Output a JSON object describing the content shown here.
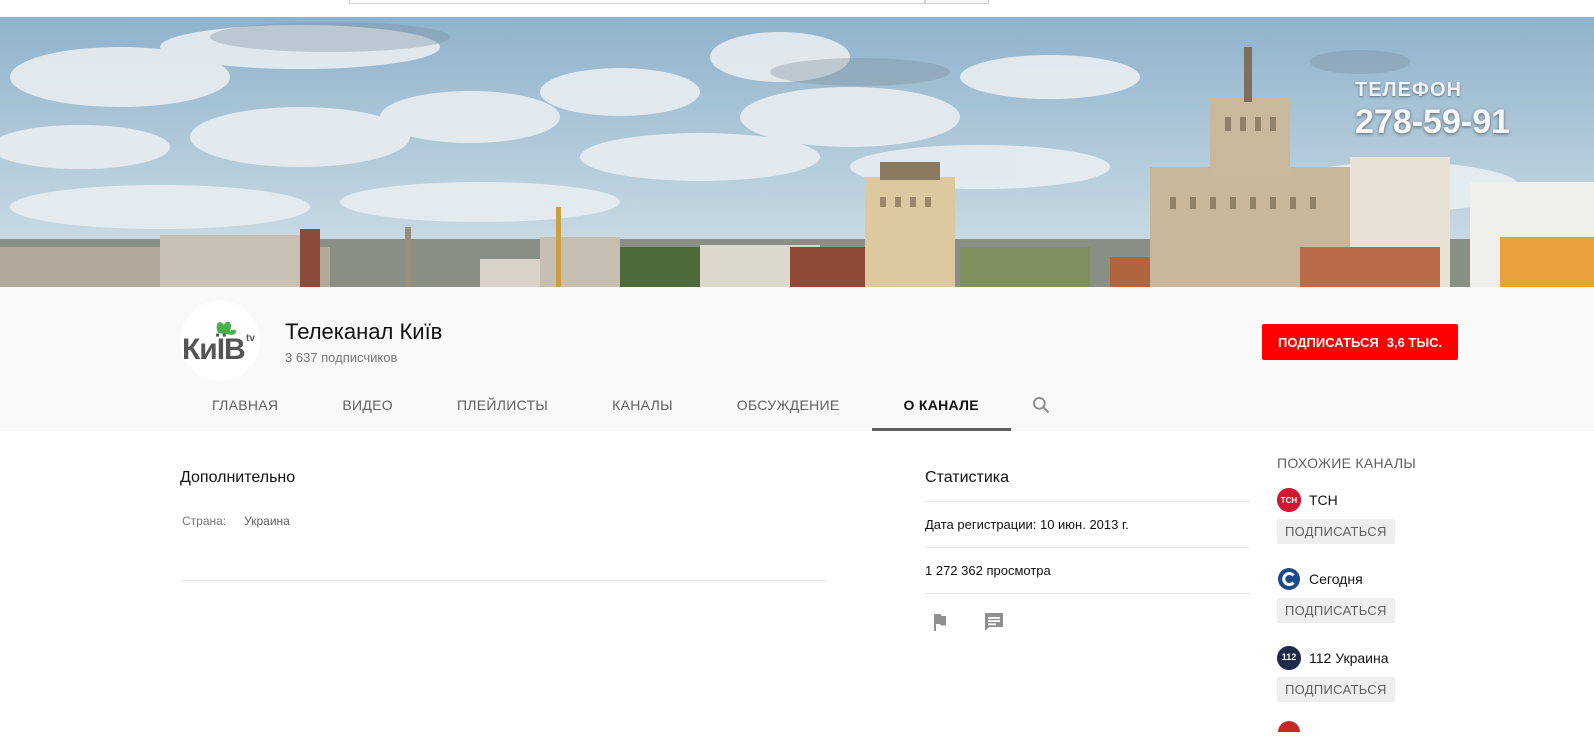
{
  "banner": {
    "phone_label": "ТЕЛЕФОН",
    "phone_number": "278-59-91"
  },
  "channel": {
    "title": "Телеканал Київ",
    "subscribers": "3 637 подписчиков",
    "subscribe_label": "ПОДПИСАТЬСЯ",
    "subscribe_count": "3,6 ТЫС.",
    "logo_text": "КиЇВ",
    "logo_suffix": "tv"
  },
  "tabs": [
    {
      "label": "ГЛАВНАЯ"
    },
    {
      "label": "ВИДЕО"
    },
    {
      "label": "ПЛЕЙЛИСТЫ"
    },
    {
      "label": "КАНАЛЫ"
    },
    {
      "label": "ОБСУЖДЕНИЕ"
    },
    {
      "label": "О КАНАЛЕ"
    }
  ],
  "active_tab": "О КАНАЛЕ",
  "about": {
    "title": "Дополнительно",
    "country_label": "Страна:",
    "country_value": "Украина"
  },
  "stats": {
    "title": "Статистика",
    "registered": "Дата регистрации: 10 июн. 2013 г.",
    "views": "1 272 362 просмотра"
  },
  "related": {
    "title": "ПОХОЖИЕ КАНАЛЫ",
    "items": [
      {
        "name": "ТСН",
        "button": "ПОДПИСАТЬСЯ",
        "logo_text": "ТСН",
        "color": "#d3172e"
      },
      {
        "name": "Сегодня",
        "button": "ПОДПИСАТЬСЯ",
        "logo_text": "С",
        "color": "#1b4b8a"
      },
      {
        "name": "112 Украина",
        "button": "ПОДПИСАТЬСЯ",
        "logo_text": "112",
        "color": "#1d2a4a"
      }
    ]
  },
  "colors": {
    "subscribe_red": "#ff0000",
    "header_bg": "#f9f9f9",
    "logo_green": "#4caf50",
    "logo_dark": "#555555"
  }
}
